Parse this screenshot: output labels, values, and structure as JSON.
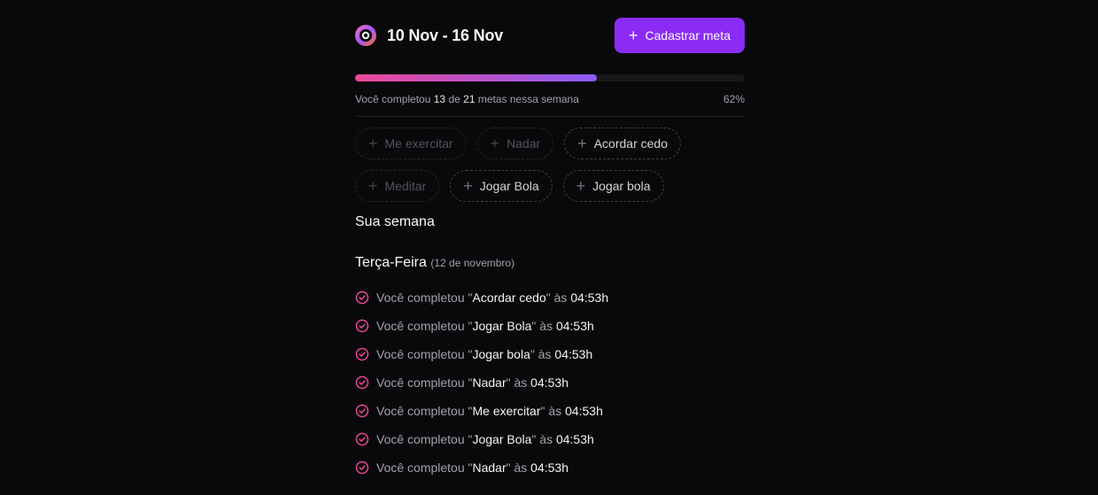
{
  "header": {
    "title": "10 Nov - 16 Nov",
    "create_button_label": "Cadastrar meta",
    "logo_icon": "app-logo-icon",
    "plus_icon": "plus-icon"
  },
  "progress": {
    "completed": "13",
    "total": "21",
    "percent_label": "62%",
    "fraction": 0.62,
    "text_prefix": "Você completou",
    "text_middle": "de",
    "text_suffix": "metas nessa semana",
    "colors": {
      "start": "#ec4899",
      "end": "#8b5cf6"
    }
  },
  "goals": [
    {
      "label": "Me exercitar",
      "disabled": true
    },
    {
      "label": "Nadar",
      "disabled": true
    },
    {
      "label": "Acordar cedo",
      "disabled": false
    },
    {
      "label": "Meditar",
      "disabled": true
    },
    {
      "label": "Jogar Bola",
      "disabled": false
    },
    {
      "label": "Jogar bola",
      "disabled": false
    }
  ],
  "week": {
    "title": "Sua semana",
    "day": {
      "name": "Terça-Feira",
      "date": "(12 de novembro)",
      "entries": [
        {
          "prefix": "Você completou \"",
          "goal": "Acordar cedo",
          "mid": "\" às ",
          "time": "04:53h"
        },
        {
          "prefix": "Você completou \"",
          "goal": "Jogar Bola",
          "mid": "\" às ",
          "time": "04:53h"
        },
        {
          "prefix": "Você completou \"",
          "goal": "Jogar bola",
          "mid": "\" às ",
          "time": "04:53h"
        },
        {
          "prefix": "Você completou \"",
          "goal": "Nadar",
          "mid": "\" às ",
          "time": "04:53h"
        },
        {
          "prefix": "Você completou \"",
          "goal": "Me exercitar",
          "mid": "\" às ",
          "time": "04:53h"
        },
        {
          "prefix": "Você completou \"",
          "goal": "Jogar Bola",
          "mid": "\" às ",
          "time": "04:53h"
        },
        {
          "prefix": "Você completou \"",
          "goal": "Nadar",
          "mid": "\" às ",
          "time": "04:53h"
        }
      ]
    }
  },
  "accent_color": "#8b2cf5",
  "check_color": "#ec4899"
}
